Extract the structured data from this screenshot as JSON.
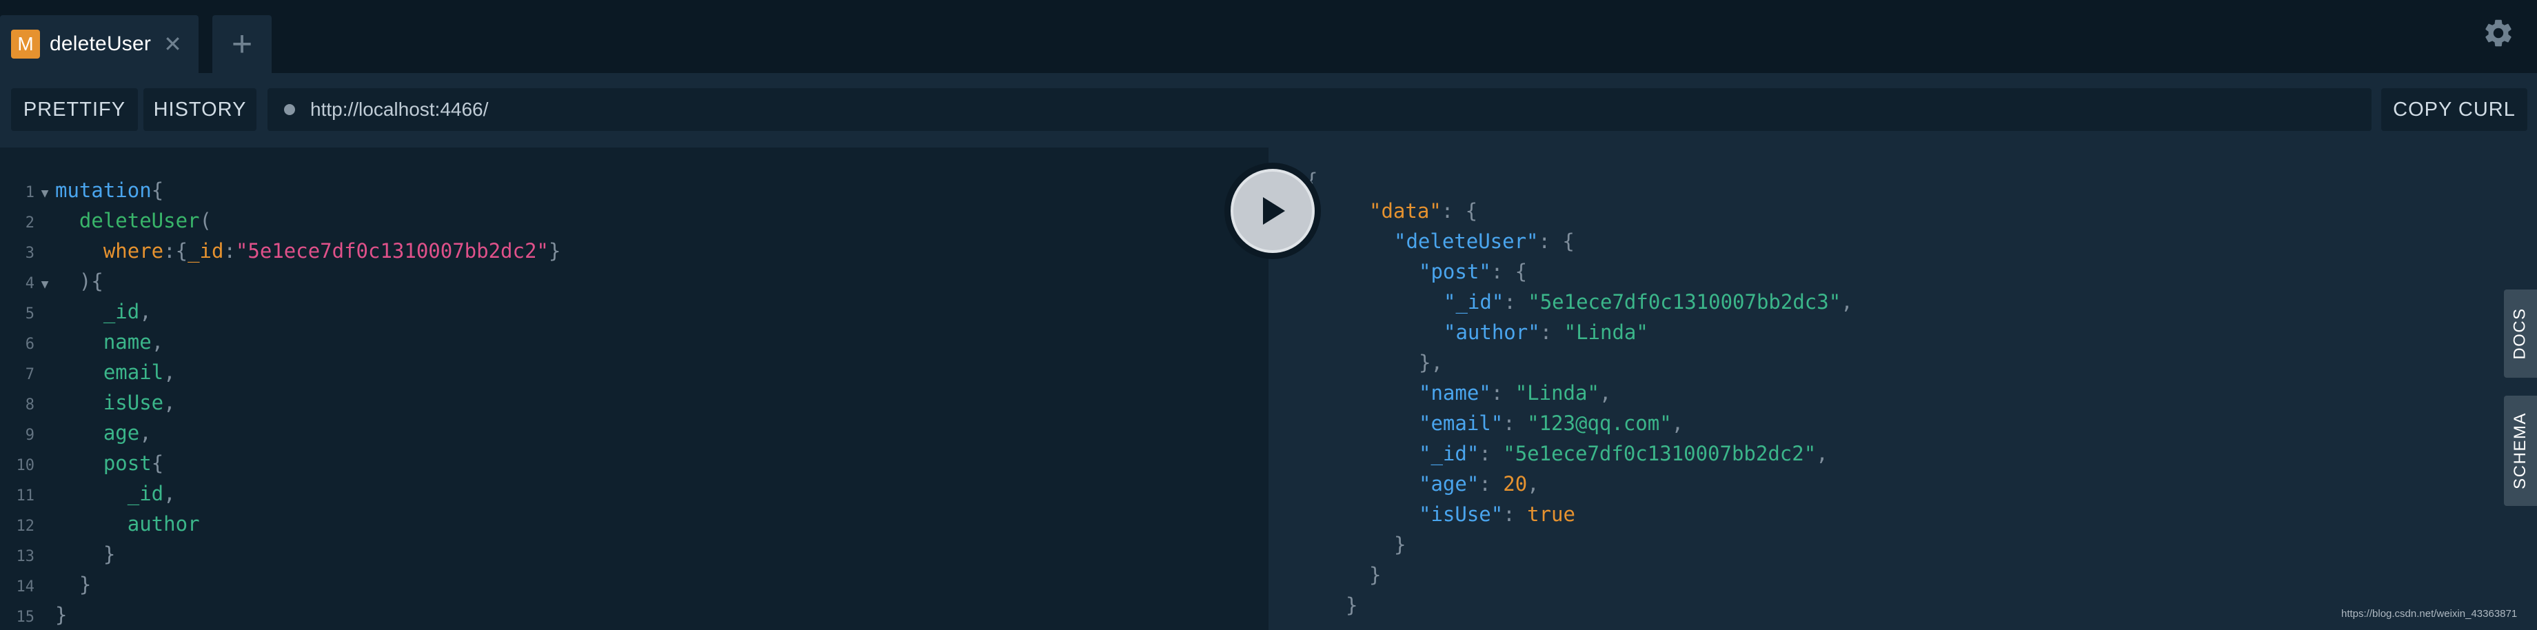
{
  "tabs": [
    {
      "badge": "M",
      "title": "deleteUser",
      "close": "✕"
    }
  ],
  "add_tab": "+",
  "toolbar": {
    "prettify": "PRETTIFY",
    "history": "HISTORY",
    "url": "http://localhost:4466/",
    "copy_curl": "COPY CURL"
  },
  "side_tabs": {
    "docs": "DOCS",
    "schema": "SCHEMA"
  },
  "editor": {
    "line_numbers": [
      "1",
      "2",
      "3",
      "4",
      "5",
      "6",
      "7",
      "8",
      "9",
      "10",
      "11",
      "12",
      "13",
      "14",
      "15"
    ],
    "l1": {
      "kw": "mutation",
      "p": "{"
    },
    "l2": {
      "fn": "deleteUser",
      "p": "("
    },
    "l3": {
      "arg": "where",
      "p1": ":{",
      "key": "_id",
      "p2": ":",
      "str": "\"5e1ece7df0c1310007bb2dc2\"",
      "p3": "}"
    },
    "l4": {
      "p": "){"
    },
    "fields": [
      "_id",
      "name",
      "email",
      "isUse",
      "age"
    ],
    "l10": {
      "fld": "post",
      "p": "{"
    },
    "sub_fields": [
      "_id",
      "author"
    ],
    "close_brace": "}",
    "comma": ","
  },
  "result": {
    "open": "{",
    "data_key": "\"data\"",
    "delete_key": "\"deleteUser\"",
    "post_key": "\"post\"",
    "post_id_key": "\"_id\"",
    "post_id_val": "\"5e1ece7df0c1310007bb2dc3\"",
    "author_key": "\"author\"",
    "author_val": "\"Linda\"",
    "name_key": "\"name\"",
    "name_val": "\"Linda\"",
    "email_key": "\"email\"",
    "email_val": "\"123@qq.com\"",
    "id_key": "\"_id\"",
    "id_val": "\"5e1ece7df0c1310007bb2dc2\"",
    "age_key": "\"age\"",
    "age_val": "20",
    "isuse_key": "\"isUse\"",
    "isuse_val": "true",
    "colon_brace": ": {",
    "colon": ": ",
    "comma": ",",
    "close_comma": "},",
    "close": "}"
  },
  "watermark": "https://blog.csdn.net/weixin_43363871",
  "colors": {
    "bg": "#0f202d",
    "panel": "#172a3a",
    "accent_orange": "#e6922f",
    "string_pink": "#e0518a",
    "field_green": "#3bb68a",
    "keyword_blue": "#4aa5ee"
  },
  "icons": [
    "settings-gear-icon",
    "play-icon",
    "close-icon",
    "plus-icon",
    "fold-arrow-icon",
    "status-dot-icon"
  ]
}
